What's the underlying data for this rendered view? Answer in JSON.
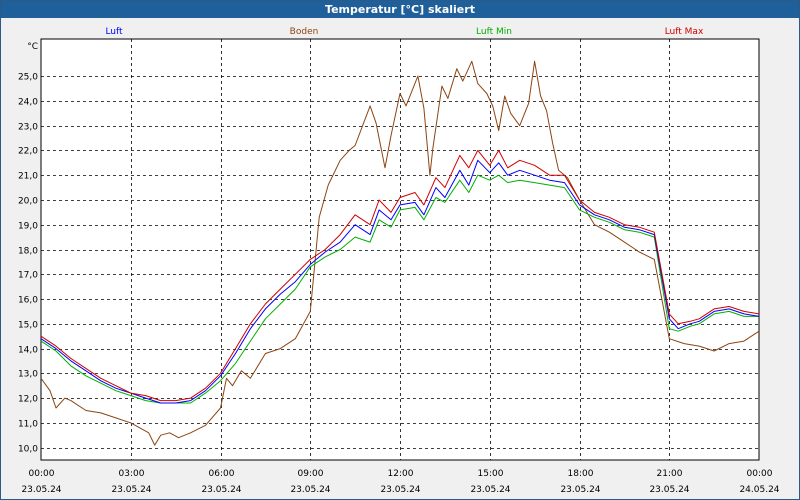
{
  "window": {
    "title": "Temperatur [°C] skaliert"
  },
  "colors": {
    "titlebar": "#1f5f9a",
    "luft": "#0000ff",
    "boden": "#8b4513",
    "luft_min": "#00b000",
    "luft_max": "#d00000",
    "plot_bg": "#ffffff"
  },
  "chart_data": {
    "type": "line",
    "title": "Temperatur [°C] skaliert",
    "ylabel": "°C",
    "xlabel": "",
    "ylim": [
      9.5,
      26.5
    ],
    "xlim": [
      0,
      24
    ],
    "grid": true,
    "legend_position": "top",
    "y_ticks": [
      10.0,
      11.0,
      12.0,
      13.0,
      14.0,
      15.0,
      16.0,
      17.0,
      18.0,
      19.0,
      20.0,
      21.0,
      22.0,
      23.0,
      24.0,
      25.0
    ],
    "y_tick_labels": [
      "10,0",
      "11,0",
      "12,0",
      "13,0",
      "14,0",
      "15,0",
      "16,0",
      "17,0",
      "18,0",
      "19,0",
      "20,0",
      "21,0",
      "22,0",
      "23,0",
      "24,0",
      "25,0"
    ],
    "x_ticks": [
      {
        "x": 0,
        "time": "00:00",
        "date": "23.05.24"
      },
      {
        "x": 3,
        "time": "03:00",
        "date": "23.05.24"
      },
      {
        "x": 6,
        "time": "06:00",
        "date": "23.05.24"
      },
      {
        "x": 9,
        "time": "09:00",
        "date": "23.05.24"
      },
      {
        "x": 12,
        "time": "12:00",
        "date": "23.05.24"
      },
      {
        "x": 15,
        "time": "15:00",
        "date": "23.05.24"
      },
      {
        "x": 18,
        "time": "18:00",
        "date": "23.05.24"
      },
      {
        "x": 21,
        "time": "21:00",
        "date": "23.05.24"
      },
      {
        "x": 24,
        "time": "00:00",
        "date": "24.05.24"
      }
    ],
    "series": [
      {
        "name": "Luft",
        "color": "#0000ff",
        "points": [
          [
            0,
            14.4
          ],
          [
            0.5,
            14.0
          ],
          [
            1,
            13.5
          ],
          [
            1.5,
            13.1
          ],
          [
            2,
            12.7
          ],
          [
            2.5,
            12.4
          ],
          [
            3,
            12.2
          ],
          [
            3.5,
            12.0
          ],
          [
            4,
            11.8
          ],
          [
            4.5,
            11.8
          ],
          [
            5,
            11.9
          ],
          [
            5.5,
            12.3
          ],
          [
            6,
            12.9
          ],
          [
            6.5,
            13.8
          ],
          [
            7,
            14.8
          ],
          [
            7.5,
            15.6
          ],
          [
            8,
            16.2
          ],
          [
            8.5,
            16.7
          ],
          [
            9,
            17.4
          ],
          [
            9.5,
            17.9
          ],
          [
            10,
            18.3
          ],
          [
            10.5,
            19.0
          ],
          [
            11,
            18.6
          ],
          [
            11.3,
            19.6
          ],
          [
            11.7,
            19.2
          ],
          [
            12,
            19.8
          ],
          [
            12.5,
            19.9
          ],
          [
            12.8,
            19.4
          ],
          [
            13.2,
            20.5
          ],
          [
            13.5,
            20.1
          ],
          [
            14,
            21.2
          ],
          [
            14.3,
            20.6
          ],
          [
            14.6,
            21.6
          ],
          [
            15,
            21.1
          ],
          [
            15.3,
            21.5
          ],
          [
            15.6,
            21.0
          ],
          [
            16,
            21.2
          ],
          [
            16.5,
            21.0
          ],
          [
            17,
            20.8
          ],
          [
            17.5,
            20.7
          ],
          [
            18,
            19.8
          ],
          [
            18.5,
            19.4
          ],
          [
            19,
            19.2
          ],
          [
            19.5,
            18.9
          ],
          [
            20,
            18.8
          ],
          [
            20.5,
            18.6
          ],
          [
            21,
            15.2
          ],
          [
            21.3,
            14.8
          ],
          [
            21.7,
            15.0
          ],
          [
            22,
            15.1
          ],
          [
            22.5,
            15.5
          ],
          [
            23,
            15.6
          ],
          [
            23.5,
            15.4
          ],
          [
            24,
            15.3
          ]
        ]
      },
      {
        "name": "Boden",
        "color": "#8b4513",
        "points": [
          [
            0,
            12.8
          ],
          [
            0.3,
            12.3
          ],
          [
            0.5,
            11.6
          ],
          [
            0.8,
            12.0
          ],
          [
            1,
            11.9
          ],
          [
            1.5,
            11.5
          ],
          [
            2,
            11.4
          ],
          [
            2.5,
            11.2
          ],
          [
            3,
            11.0
          ],
          [
            3.3,
            10.8
          ],
          [
            3.6,
            10.6
          ],
          [
            3.8,
            10.1
          ],
          [
            4,
            10.5
          ],
          [
            4.3,
            10.6
          ],
          [
            4.6,
            10.4
          ],
          [
            5,
            10.6
          ],
          [
            5.5,
            10.9
          ],
          [
            6,
            11.6
          ],
          [
            6.2,
            12.8
          ],
          [
            6.4,
            12.5
          ],
          [
            6.7,
            13.1
          ],
          [
            7,
            12.8
          ],
          [
            7.5,
            13.8
          ],
          [
            8,
            14.0
          ],
          [
            8.5,
            14.4
          ],
          [
            9,
            15.5
          ],
          [
            9.3,
            19.3
          ],
          [
            9.6,
            20.6
          ],
          [
            10,
            21.6
          ],
          [
            10.3,
            22.0
          ],
          [
            10.5,
            22.2
          ],
          [
            11,
            23.8
          ],
          [
            11.2,
            23.1
          ],
          [
            11.5,
            21.3
          ],
          [
            11.7,
            22.6
          ],
          [
            12,
            24.3
          ],
          [
            12.2,
            23.8
          ],
          [
            12.6,
            25.0
          ],
          [
            12.8,
            23.7
          ],
          [
            13,
            21.0
          ],
          [
            13.1,
            22.1
          ],
          [
            13.4,
            24.6
          ],
          [
            13.6,
            24.1
          ],
          [
            13.9,
            25.3
          ],
          [
            14.1,
            24.8
          ],
          [
            14.4,
            25.6
          ],
          [
            14.6,
            24.7
          ],
          [
            14.9,
            24.3
          ],
          [
            15.1,
            23.8
          ],
          [
            15.3,
            22.8
          ],
          [
            15.5,
            24.2
          ],
          [
            15.7,
            23.5
          ],
          [
            16,
            23.0
          ],
          [
            16.3,
            23.9
          ],
          [
            16.5,
            25.6
          ],
          [
            16.7,
            24.2
          ],
          [
            16.9,
            23.6
          ],
          [
            17.1,
            22.3
          ],
          [
            17.3,
            21.2
          ],
          [
            17.6,
            20.9
          ],
          [
            18,
            20.0
          ],
          [
            18.5,
            19.0
          ],
          [
            19,
            18.7
          ],
          [
            19.5,
            18.3
          ],
          [
            20,
            17.9
          ],
          [
            20.5,
            17.6
          ],
          [
            21,
            14.4
          ],
          [
            21.5,
            14.2
          ],
          [
            22,
            14.1
          ],
          [
            22.5,
            13.9
          ],
          [
            23,
            14.2
          ],
          [
            23.5,
            14.3
          ],
          [
            24,
            14.7
          ]
        ]
      },
      {
        "name": "Luft Min",
        "color": "#00b000",
        "points": [
          [
            0,
            14.3
          ],
          [
            0.5,
            13.9
          ],
          [
            1,
            13.3
          ],
          [
            1.5,
            12.9
          ],
          [
            2,
            12.6
          ],
          [
            2.5,
            12.3
          ],
          [
            3,
            12.1
          ],
          [
            3.5,
            11.9
          ],
          [
            4,
            11.8
          ],
          [
            4.5,
            11.8
          ],
          [
            5,
            11.8
          ],
          [
            5.5,
            12.2
          ],
          [
            6,
            12.7
          ],
          [
            6.5,
            13.4
          ],
          [
            7,
            14.3
          ],
          [
            7.5,
            15.2
          ],
          [
            8,
            15.8
          ],
          [
            8.5,
            16.4
          ],
          [
            9,
            17.3
          ],
          [
            9.5,
            17.7
          ],
          [
            10,
            18.0
          ],
          [
            10.5,
            18.5
          ],
          [
            11,
            18.3
          ],
          [
            11.3,
            19.2
          ],
          [
            11.7,
            18.9
          ],
          [
            12,
            19.6
          ],
          [
            12.5,
            19.7
          ],
          [
            12.8,
            19.2
          ],
          [
            13.2,
            20.1
          ],
          [
            13.5,
            19.9
          ],
          [
            14,
            20.8
          ],
          [
            14.3,
            20.3
          ],
          [
            14.6,
            21.0
          ],
          [
            15,
            20.8
          ],
          [
            15.3,
            21.0
          ],
          [
            15.6,
            20.7
          ],
          [
            16,
            20.8
          ],
          [
            16.5,
            20.7
          ],
          [
            17,
            20.6
          ],
          [
            17.5,
            20.5
          ],
          [
            18,
            19.6
          ],
          [
            18.5,
            19.3
          ],
          [
            19,
            19.1
          ],
          [
            19.5,
            18.8
          ],
          [
            20,
            18.7
          ],
          [
            20.5,
            18.5
          ],
          [
            21,
            14.8
          ],
          [
            21.3,
            14.7
          ],
          [
            21.7,
            14.9
          ],
          [
            22,
            15.0
          ],
          [
            22.5,
            15.4
          ],
          [
            23,
            15.5
          ],
          [
            23.5,
            15.3
          ],
          [
            24,
            15.3
          ]
        ]
      },
      {
        "name": "Luft Max",
        "color": "#d00000",
        "points": [
          [
            0,
            14.5
          ],
          [
            0.5,
            14.1
          ],
          [
            1,
            13.6
          ],
          [
            1.5,
            13.2
          ],
          [
            2,
            12.8
          ],
          [
            2.5,
            12.5
          ],
          [
            3,
            12.2
          ],
          [
            3.5,
            12.1
          ],
          [
            4,
            11.9
          ],
          [
            4.5,
            11.9
          ],
          [
            5,
            12.0
          ],
          [
            5.5,
            12.4
          ],
          [
            6,
            13.0
          ],
          [
            6.5,
            14.0
          ],
          [
            7,
            15.0
          ],
          [
            7.5,
            15.8
          ],
          [
            8,
            16.4
          ],
          [
            8.5,
            17.0
          ],
          [
            9,
            17.6
          ],
          [
            9.5,
            18.0
          ],
          [
            10,
            18.6
          ],
          [
            10.5,
            19.4
          ],
          [
            11,
            19.0
          ],
          [
            11.3,
            20.0
          ],
          [
            11.7,
            19.5
          ],
          [
            12,
            20.1
          ],
          [
            12.5,
            20.3
          ],
          [
            12.8,
            19.8
          ],
          [
            13.2,
            20.9
          ],
          [
            13.5,
            20.5
          ],
          [
            14,
            21.8
          ],
          [
            14.3,
            21.3
          ],
          [
            14.6,
            22.0
          ],
          [
            15,
            21.4
          ],
          [
            15.3,
            22.0
          ],
          [
            15.6,
            21.3
          ],
          [
            16,
            21.6
          ],
          [
            16.5,
            21.4
          ],
          [
            17,
            21.0
          ],
          [
            17.5,
            21.0
          ],
          [
            18,
            20.0
          ],
          [
            18.5,
            19.5
          ],
          [
            19,
            19.3
          ],
          [
            19.5,
            19.0
          ],
          [
            20,
            18.9
          ],
          [
            20.5,
            18.7
          ],
          [
            21,
            15.4
          ],
          [
            21.3,
            15.0
          ],
          [
            21.7,
            15.1
          ],
          [
            22,
            15.2
          ],
          [
            22.5,
            15.6
          ],
          [
            23,
            15.7
          ],
          [
            23.5,
            15.5
          ],
          [
            24,
            15.4
          ]
        ]
      }
    ]
  }
}
